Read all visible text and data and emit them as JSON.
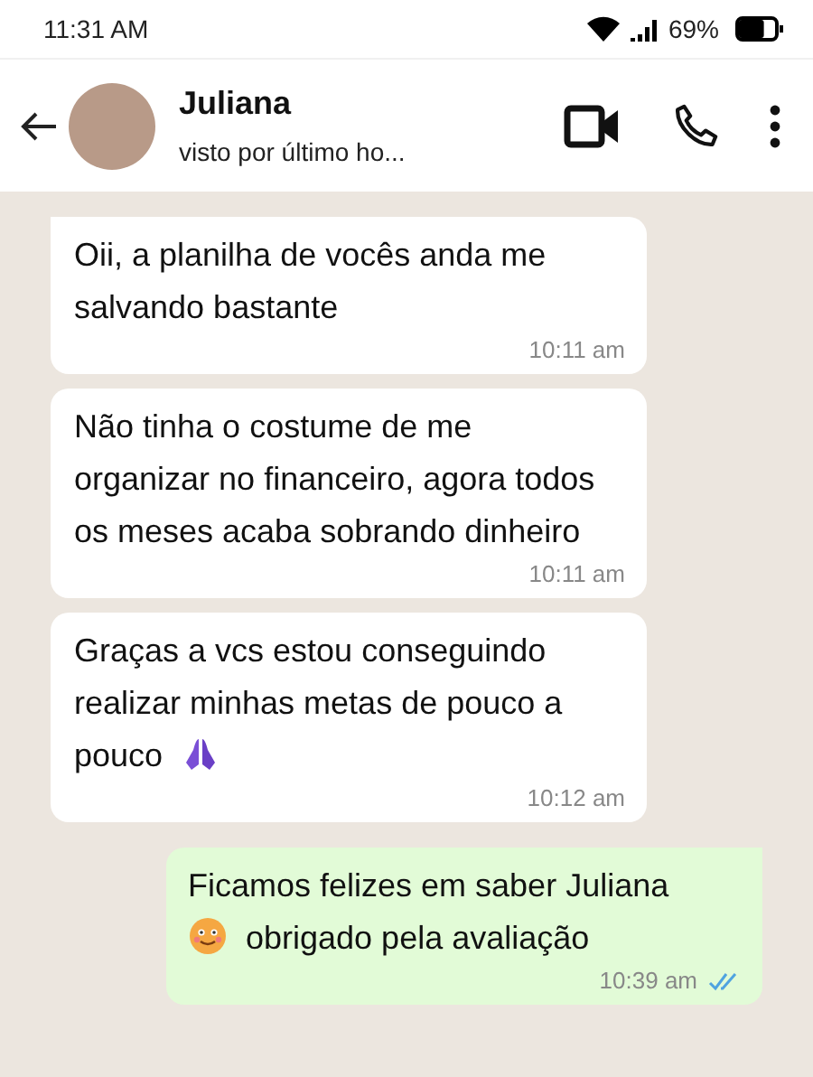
{
  "status_bar": {
    "time": "11:31 AM",
    "battery": "69%",
    "battery_meter": {
      "level": 0.69
    }
  },
  "header": {
    "name": "Juliana",
    "subtitle": "visto por último ho..."
  },
  "messages": [
    {
      "kind": "in",
      "tail": true,
      "lines": [
        [
          {
            "kind": "text",
            "text": "Oii, a planilha de vocês anda me salvando bastante"
          }
        ]
      ],
      "time": "10:11 am"
    },
    {
      "kind": "in",
      "tail": false,
      "lines": [
        [
          {
            "kind": "text",
            "text": "Não tinha o costume de me organizar no financeiro, agora todos os meses acaba sobrando dinheiro"
          }
        ]
      ],
      "time": "10:11 am"
    },
    {
      "kind": "in",
      "tail": false,
      "lines": [
        [
          {
            "kind": "text",
            "text": "Graças a vcs estou conseguindo realizar minhas metas de pouco a"
          }
        ],
        [
          {
            "kind": "text",
            "text": "pouco"
          },
          {
            "kind": "hands"
          }
        ]
      ],
      "time": "10:12 am"
    },
    {
      "kind": "out",
      "tail": true,
      "read": true,
      "lines": [
        [
          {
            "kind": "text",
            "text": "Ficamos felizes em saber Juliana"
          }
        ],
        [
          {
            "kind": "smiley"
          },
          {
            "kind": "text",
            "text": "obrigado pela avaliação"
          }
        ]
      ],
      "time": "10:39 am"
    }
  ]
}
